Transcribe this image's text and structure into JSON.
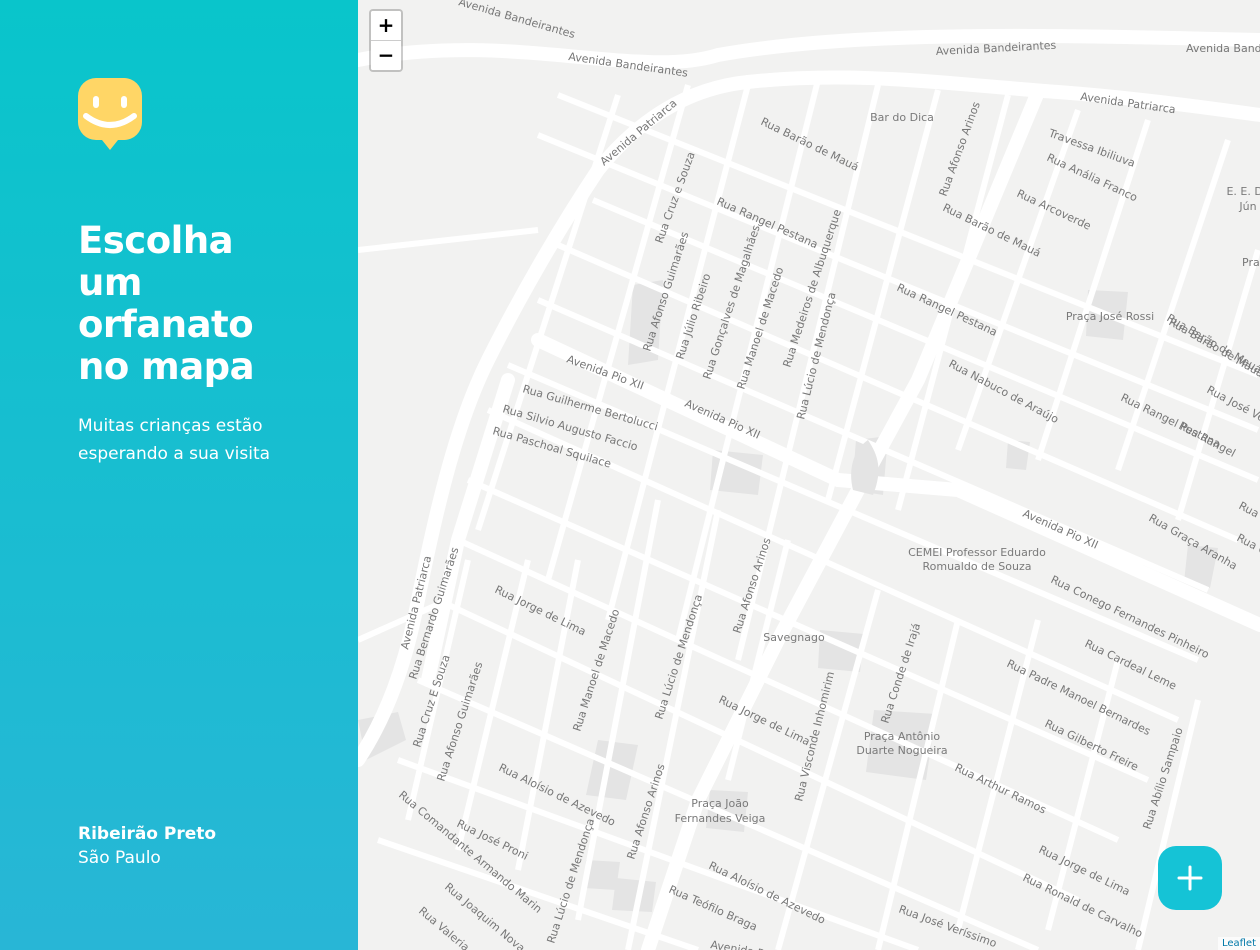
{
  "sidebar": {
    "title": "Escolha um orfanato no mapa",
    "subtitle": "Muitas crianças estão esperando a sua visita",
    "city": "Ribeirão Preto",
    "state": "São Paulo",
    "logo_icon": "smiley-pin-icon",
    "gradient_colors": [
      "#09C5CB",
      "#28B6D6"
    ],
    "logo_color": "#FFD666"
  },
  "map": {
    "zoom_in_label": "+",
    "zoom_out_label": "−",
    "attribution": "Leaflet",
    "add_button_icon": "plus-icon",
    "add_button_color": "#15C3D6",
    "streets": [
      "Avenida Bandeirantes",
      "Avenida Bandeirantes",
      "Avenida Bandeirantes",
      "Avenida Bandeirantes",
      "Avenida Patriarca",
      "Avenida Patriarca",
      "Avenida Patriarca",
      "Rua Barão de Mauá",
      "Rua Barão de Mauá",
      "Rua Barão de Mauá",
      "Rua Afonso Arinos",
      "Travessa Ibiliuva",
      "Rua Anália Franco",
      "Rua Arcoverde",
      "Rua Cruz e Souza",
      "Rua Rangel Pestana",
      "Rua Afonso Guimarães",
      "Rua Júlio Ribeiro",
      "Rua Gonçalves de Magalhães",
      "Rua Manoel de Macedo",
      "Rua Medeiros de Albuquerque",
      "Rua Lúcio de Mendonça",
      "Rua Rangel Pestana",
      "Rua Nabuco de Araújo",
      "Rua Rangel Pestana",
      "Avenida Pio XII",
      "Avenida Pio XII",
      "Avenida Pio XII",
      "Rua Guilherme Bertolucci",
      "Rua Silvio Augusto Faccio",
      "Rua Paschoal Squilace",
      "Rua Graça Aranha",
      "Rua Conego Fernandes Pinheiro",
      "Rua Cardeal Leme",
      "Rua Padre Manoel Bernardes",
      "Rua Gilberto Freire",
      "Rua Arthur Ramos",
      "Rua Jorge de Lima",
      "Rua Jorge de Lima",
      "Rua Jorge de Lima",
      "Rua Ronald de Carvalho",
      "Rua José Veríssimo",
      "Rua Abílio Sampaio",
      "Rua Conde de Irajá",
      "Rua Visconde Inhomirim",
      "Rua Afonso Arinos",
      "Rua Afonso Arinos",
      "Rua Lúcio de Mendonça",
      "Rua Lúcio de Mendonça",
      "Rua Manoel de Macedo",
      "Rua Bernardo Guimarães",
      "Rua Cruz E Souza",
      "Rua Afonso Guimarães",
      "Rua Aloísio de Azevedo",
      "Rua Aloísio de Azevedo",
      "Rua José Proni",
      "Rua Comandante Armando Marin",
      "Rua Joaquim Nova",
      "Rua Valeria",
      "Rua Teófilo Braga",
      "Avenida Patriarca",
      "Rua José Ve",
      "Rua Barão de Mauá",
      "Rua Rangel",
      "Rua M",
      "Rua Gra",
      "Pra"
    ],
    "places": [
      "Bar do Dica",
      "Praça José Rossi",
      "E. E. Do",
      "Jún",
      "CEMEI Professor Eduardo",
      "Romualdo de Souza",
      "Savegnago",
      "Praça Antônio",
      "Duarte Nogueira",
      "Praça João",
      "Fernandes Veiga"
    ]
  }
}
